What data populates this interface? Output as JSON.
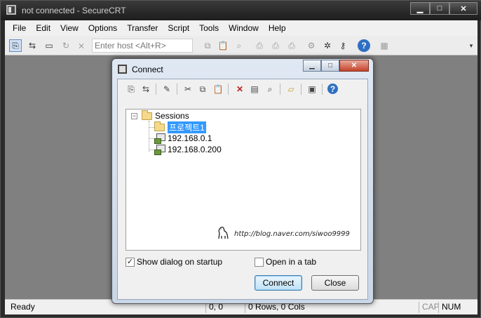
{
  "app": {
    "title": "not connected - SecureCRT",
    "caption_buttons": {
      "minimize": "▁",
      "maximize": "□",
      "close": "✕"
    }
  },
  "menubar": [
    "File",
    "Edit",
    "View",
    "Options",
    "Transfer",
    "Script",
    "Tools",
    "Window",
    "Help"
  ],
  "toolbar": {
    "host_placeholder": "Enter host <Alt+R>",
    "buttons": [
      {
        "name": "connect-icon",
        "glyph": "⎘"
      },
      {
        "name": "quick-connect-icon",
        "glyph": "⇆"
      },
      {
        "name": "connect-in-tab-icon",
        "glyph": "▭"
      },
      {
        "name": "reconnect-icon",
        "glyph": "↻"
      },
      {
        "name": "disconnect-icon",
        "glyph": "⨯"
      },
      {
        "name": "copy-icon",
        "glyph": "⧉"
      },
      {
        "name": "paste-icon",
        "glyph": "📋"
      },
      {
        "name": "find-icon",
        "glyph": "⌕"
      },
      {
        "name": "print-icon",
        "glyph": "⎙"
      },
      {
        "name": "print-selection-icon",
        "glyph": "⎙"
      },
      {
        "name": "print-screen-icon",
        "glyph": "⎙"
      },
      {
        "name": "session-options-icon",
        "glyph": "⚙"
      },
      {
        "name": "global-options-icon",
        "glyph": "✲"
      },
      {
        "name": "keymap-icon",
        "glyph": "⚷"
      },
      {
        "name": "help-icon",
        "glyph": "?"
      },
      {
        "name": "sftp-icon",
        "glyph": "▦"
      }
    ]
  },
  "status_bar": {
    "ready": "Ready",
    "position": "0, 0",
    "size": "0 Rows, 0 Cols",
    "cap": "CAP",
    "num": "NUM"
  },
  "dialog": {
    "title": "Connect",
    "caption_buttons": {
      "minimize": "▁",
      "maximize": "□",
      "close": "✕"
    },
    "toolbar": [
      {
        "name": "connect-icon",
        "glyph": "⎘"
      },
      {
        "name": "quick-connect-icon",
        "glyph": "⇆"
      },
      {
        "name": "new-folder-session-icon",
        "glyph": "✎"
      },
      {
        "name": "cut-icon",
        "glyph": "✂"
      },
      {
        "name": "copy-icon",
        "glyph": "⧉"
      },
      {
        "name": "paste-icon",
        "glyph": "📋"
      },
      {
        "name": "delete-icon",
        "glyph": "✕"
      },
      {
        "name": "properties-icon",
        "glyph": "▤"
      },
      {
        "name": "find-icon",
        "glyph": "⌕"
      },
      {
        "name": "new-folder-icon",
        "glyph": "▱"
      },
      {
        "name": "create-shortcut-icon",
        "glyph": "▣"
      },
      {
        "name": "help-icon",
        "glyph": "?"
      }
    ],
    "tree": {
      "root": "Sessions",
      "children": [
        {
          "label": "프로젝트1",
          "type": "folder",
          "selected": true
        },
        {
          "label": "192.168.0.1",
          "type": "session"
        },
        {
          "label": "192.168.0.200",
          "type": "session"
        }
      ]
    },
    "watermark": "http://blog.naver.com/siwoo9999",
    "show_dialog_on_startup": {
      "label": "Show dialog on startup",
      "checked": true
    },
    "open_in_tab": {
      "label": "Open in a tab",
      "checked": false
    },
    "connect_button": "Connect",
    "close_button": "Close"
  },
  "colors": {
    "selection": "#3399ff",
    "close_button": "#c5432b",
    "client_background": "#808080"
  }
}
